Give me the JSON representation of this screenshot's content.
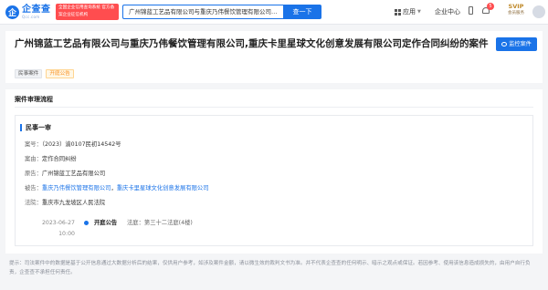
{
  "header": {
    "logo_mark": "企",
    "logo_name": "企查查",
    "logo_sub": "Qcc.com",
    "red_badge": "全国企业信用查询系统 官方备案企业征信机构",
    "search_value": "广州锦蓝工艺品有限公司与重庆乃伟餐饮管理有限公司…",
    "search_button": "查一下",
    "nav_app": "应用",
    "nav_enterprise": "企业中心",
    "bell_count": "5",
    "svip_top": "SVIP",
    "svip_bottom": "会员服务"
  },
  "case": {
    "title": "广州锦蓝工艺品有限公司与重庆乃伟餐饮管理有限公司,重庆卡里星球文化创意发展有限公司定作合同纠纷的案件",
    "monitor_button": "监控案件",
    "tags": [
      "民事案件",
      "开庭公告"
    ]
  },
  "process": {
    "section_title": "案件审理流程",
    "stage": "民事一审",
    "case_no_label": "案号：",
    "case_no": "（2023）渝0107民初14542号",
    "cause_label": "案由：",
    "cause": "定作合同纠纷",
    "plaintiff_label": "原告：",
    "plaintiff": "广州锦蓝工艺品有限公司",
    "defendant_label": "被告：",
    "defendant_1": "重庆乃伟餐饮管理有限公司",
    "defendant_sep": "，",
    "defendant_2": "重庆卡里星球文化创意发展有限公司",
    "court_label": "法院：",
    "court": "重庆市九龙坡区人民法院",
    "timeline": {
      "date": "2023-06-27",
      "time": "10:00",
      "type": "开庭公告",
      "venue": "法庭：第三十二法庭(4楼)"
    }
  },
  "footnote": "提示：司法案件中的数据是基于公开信息通过大数据分析后的结果，仅供用户参考，如涉及案件金额，请以微生效的裁判文书为准。并不代表企查查的任何明示、暗示之观点或保证。若因参考、使用该信息造成损失的，由用户自行负责，企查查不承担任何责任。",
  "colors": {
    "accent": "#1a73e8",
    "danger": "#ff4d4f",
    "warning": "#fa8c16"
  }
}
